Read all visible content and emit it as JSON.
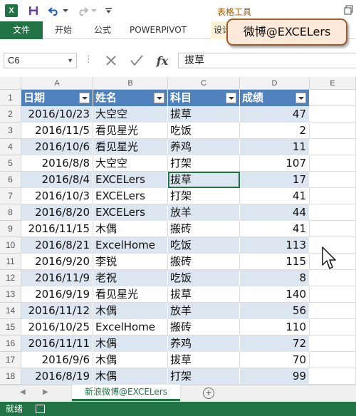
{
  "titlebar": {
    "app_icon_text": "X",
    "context_tab_group": "表格工具",
    "icons": [
      "excel-logo-icon",
      "save-icon",
      "undo-icon",
      "redo-icon",
      "customize-qa-icon",
      "restore-window-icon"
    ]
  },
  "ribbon": {
    "file_label": "文件",
    "tabs": [
      "开始",
      "公式",
      "POWERPIVOT",
      "设计"
    ]
  },
  "bubble": {
    "text": "微博@EXCELers"
  },
  "formula_bar": {
    "name_box": "C6",
    "formula_value": "拔草",
    "fx_label": "fx"
  },
  "grid": {
    "columns": [
      "A",
      "B",
      "C",
      "D",
      "E"
    ],
    "row_numbers": [
      "1",
      "2",
      "3",
      "4",
      "5",
      "6",
      "7",
      "8",
      "9",
      "10",
      "11",
      "12",
      "13",
      "14",
      "15",
      "16",
      "17",
      "18"
    ],
    "headers": [
      "日期",
      "姓名",
      "科目",
      "成绩"
    ],
    "rows": [
      [
        "2016/10/23",
        "大空空",
        "拔草",
        "47"
      ],
      [
        "2016/11/5",
        "看见星光",
        "吃饭",
        "2"
      ],
      [
        "2016/10/6",
        "看见星光",
        "养鸡",
        "11"
      ],
      [
        "2016/8/8",
        "大空空",
        "打架",
        "107"
      ],
      [
        "2016/8/4",
        "EXCELers",
        "拔草",
        "17"
      ],
      [
        "2016/10/3",
        "EXCELers",
        "打架",
        "41"
      ],
      [
        "2016/8/20",
        "EXCELers",
        "放羊",
        "44"
      ],
      [
        "2016/11/15",
        "木偶",
        "搬砖",
        "41"
      ],
      [
        "2016/8/21",
        "ExcelHome",
        "吃饭",
        "113"
      ],
      [
        "2016/9/20",
        "李锐",
        "搬砖",
        "115"
      ],
      [
        "2016/11/9",
        "老祝",
        "吃饭",
        "8"
      ],
      [
        "2016/9/19",
        "看见星光",
        "拔草",
        "140"
      ],
      [
        "2016/11/12",
        "木偶",
        "放羊",
        "56"
      ],
      [
        "2016/10/25",
        "ExcelHome",
        "搬砖",
        "110"
      ],
      [
        "2016/11/11",
        "木偶",
        "养鸡",
        "72"
      ],
      [
        "2016/9/6",
        "木偶",
        "拔草",
        "70"
      ],
      [
        "2016/8/19",
        "木偶",
        "打架",
        "99"
      ]
    ],
    "selected_cell": "C6"
  },
  "sheet_tabs": {
    "active": "新浪微博@EXCELers",
    "add_symbol": "+"
  },
  "status": {
    "text": "就绪"
  },
  "colors": {
    "excel_green": "#217346",
    "table_header": "#4f81bd",
    "table_band": "#dce6f1",
    "context_tab": "#9c5700",
    "bubble_fill": "#fde9d9",
    "bubble_border": "#a05a28"
  }
}
